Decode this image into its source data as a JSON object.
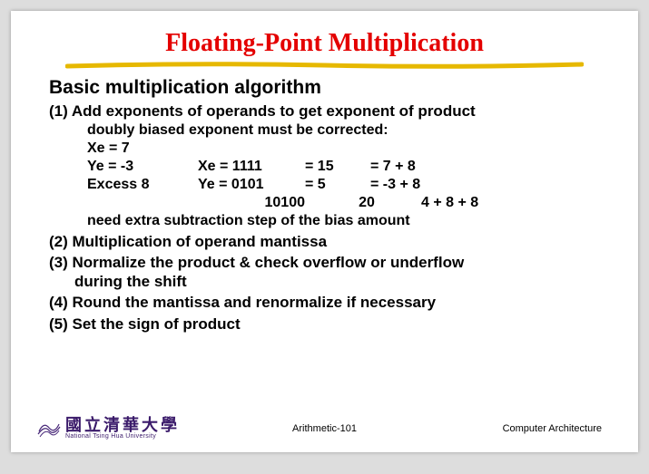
{
  "title": "Floating-Point Multiplication",
  "subtitle": "Basic multiplication algorithm",
  "step1": {
    "heading": "(1) Add exponents of operands to get exponent of product",
    "note": "doubly biased exponent must be corrected:",
    "left": {
      "l1": "Xe = 7",
      "l2": "Ye = -3",
      "l3": "Excess 8"
    },
    "table": {
      "r1c1": "Xe = 1111",
      "r1c2": "=  15",
      "r1c3": "=  7 + 8",
      "r2c1": "Ye = 0101",
      "r2c2": "=   5",
      "r2c3": "= -3 + 8",
      "r3c1": "10100",
      "r3c2": "20",
      "r3c3": "4 + 8 + 8"
    },
    "conclusion": "need extra subtraction step of the bias amount"
  },
  "step2": "(2) Multiplication of operand mantissa",
  "step3_a": "(3) Normalize the product & check overflow or underflow",
  "step3_b": "during the shift",
  "step4": "(4) Round the mantissa and renormalize if necessary",
  "step5": "(5) Set the sign of product",
  "footer": {
    "logo_cn": "國立清華大學",
    "logo_en": "National Tsing Hua University",
    "center": "Arithmetic-101",
    "right": "Computer Architecture"
  }
}
